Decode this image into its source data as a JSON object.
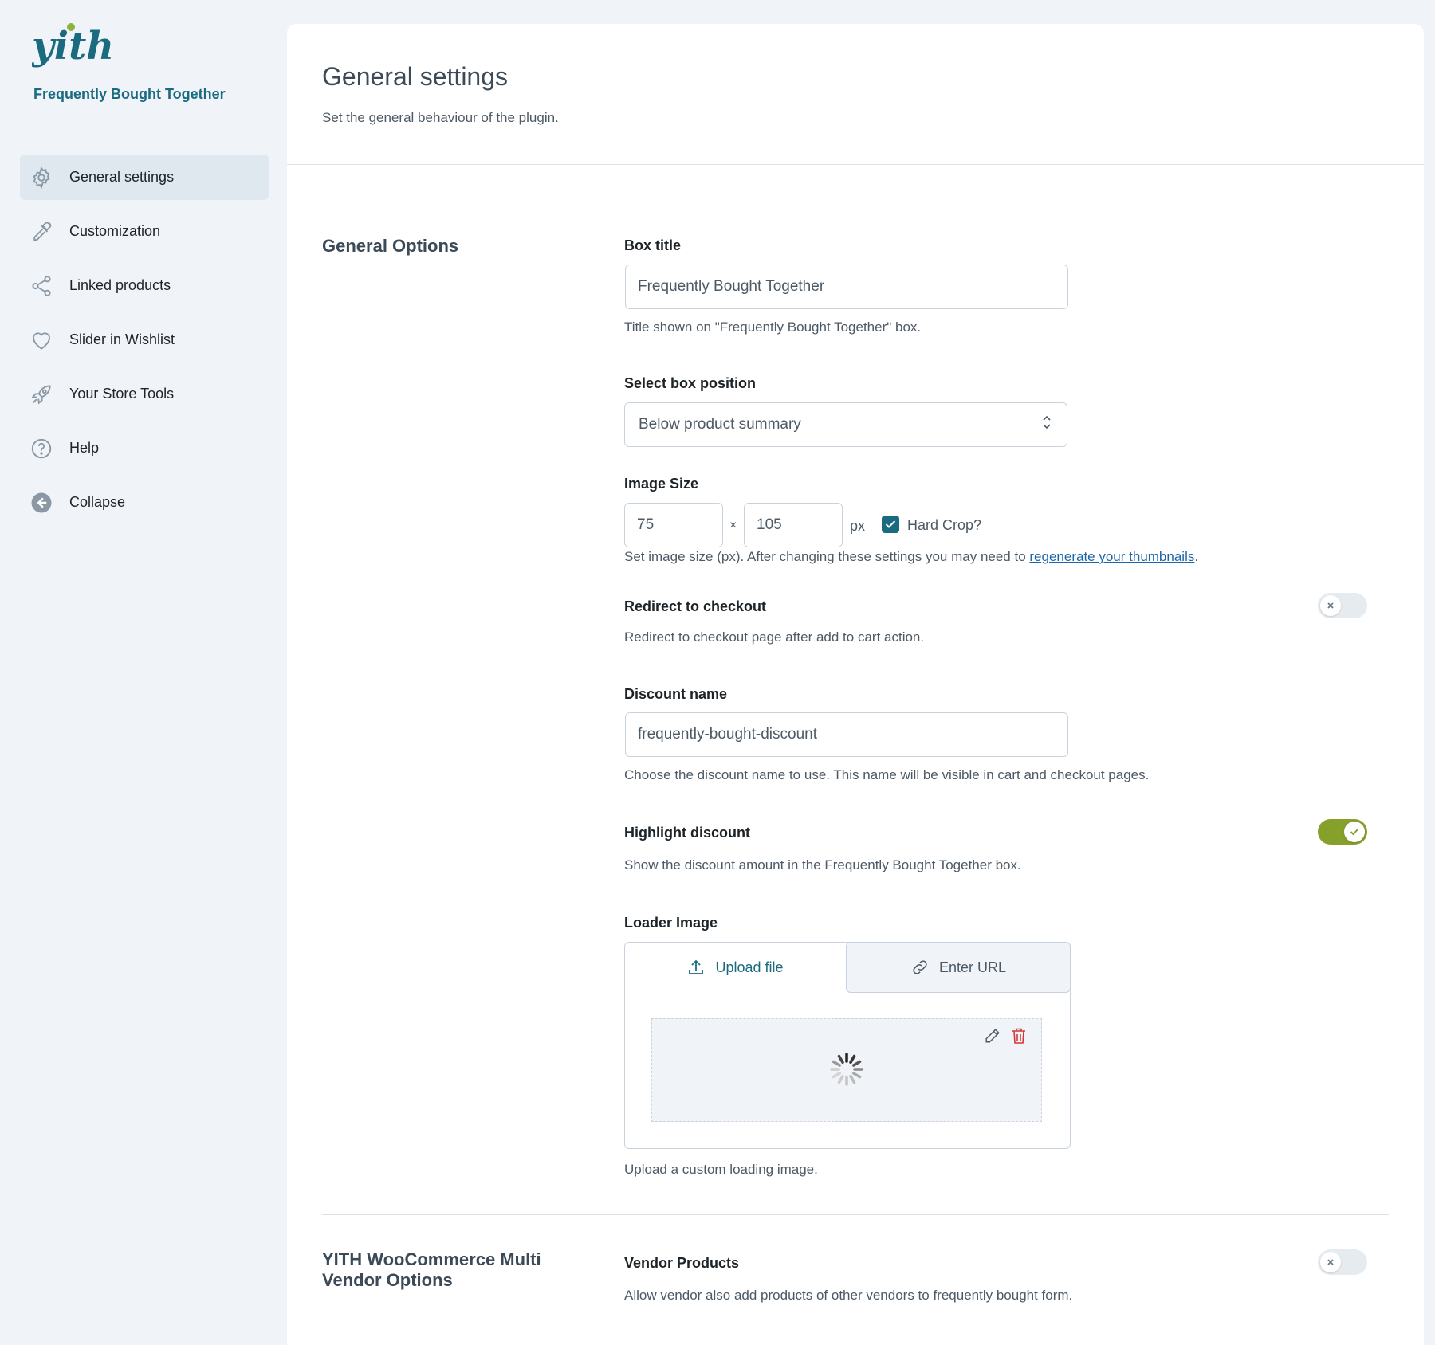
{
  "brand": {
    "logo_text": "yith",
    "plugin_name": "Frequently Bought Together",
    "accent": "#1a6a80",
    "toggle_on_color": "#86a02c"
  },
  "sidebar": {
    "items": [
      {
        "label": "General settings",
        "icon": "gear-icon",
        "active": true
      },
      {
        "label": "Customization",
        "icon": "eyedropper-icon",
        "active": false
      },
      {
        "label": "Linked products",
        "icon": "share-icon",
        "active": false
      },
      {
        "label": "Slider in Wishlist",
        "icon": "heart-icon",
        "active": false
      },
      {
        "label": "Your Store Tools",
        "icon": "rocket-icon",
        "active": false
      },
      {
        "label": "Help",
        "icon": "help-icon",
        "active": false
      },
      {
        "label": "Collapse",
        "icon": "arrow-left-circle-icon",
        "active": false
      }
    ]
  },
  "page": {
    "title": "General settings",
    "subtitle": "Set the general behaviour of the plugin."
  },
  "general_options": {
    "section_title": "General Options",
    "box_title": {
      "label": "Box title",
      "value": "Frequently Bought Together",
      "description": "Title shown on \"Frequently Bought Together\" box."
    },
    "box_position": {
      "label": "Select box position",
      "value": "Below product summary"
    },
    "image_size": {
      "label": "Image Size",
      "width": "75",
      "times": "×",
      "height": "105",
      "unit": "px",
      "hard_crop_label": "Hard Crop?",
      "hard_crop": true,
      "description_prefix": "Set image size (px). After changing these settings you may need to ",
      "description_link": "regenerate your thumbnails",
      "description_suffix": "."
    },
    "redirect": {
      "label": "Redirect to checkout",
      "enabled": false,
      "description": "Redirect to checkout page after add to cart action."
    },
    "discount_name": {
      "label": "Discount name",
      "value": "frequently-bought-discount",
      "description": "Choose the discount name to use. This name will be visible in cart and checkout pages."
    },
    "highlight_discount": {
      "label": "Highlight discount",
      "enabled": true,
      "description": "Show the discount amount in the Frequently Bought Together box."
    },
    "loader_image": {
      "label": "Loader Image",
      "upload_tab": "Upload file",
      "url_tab": "Enter URL",
      "description": "Upload a custom loading image."
    }
  },
  "vendor_options": {
    "section_title": "YITH WooCommerce Multi Vendor Options",
    "vendor_products": {
      "label": "Vendor Products",
      "enabled": false,
      "description": "Allow vendor also add products of other vendors to frequently bought form."
    }
  }
}
